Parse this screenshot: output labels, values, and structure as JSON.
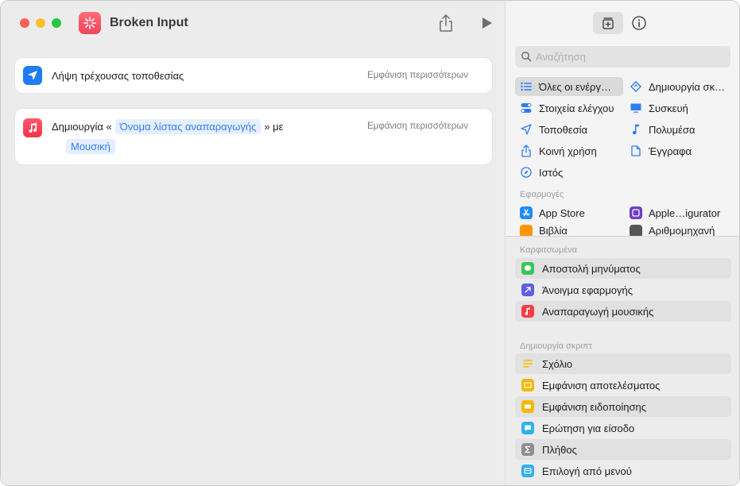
{
  "window": {
    "title": "Broken Input"
  },
  "actions": [
    {
      "text": "Λήψη τρέχουσας τοποθεσίας",
      "more": "Εμφάνιση περισσότερων"
    },
    {
      "prefix": "Δημιουργία «",
      "token1": "Όνομα λίστας αναπαραγωγής",
      "middle": "» με",
      "token2": "Μουσική",
      "more": "Εμφάνιση περισσότερων"
    }
  ],
  "sidebar": {
    "search_placeholder": "Αναζήτηση",
    "categories": [
      {
        "label": "Όλες οι ενέργ…",
        "icon": "list-icon"
      },
      {
        "label": "Δημιουργία σκ…",
        "icon": "script-icon"
      },
      {
        "label": "Στοιχεία ελέγχου",
        "icon": "toggle-icon"
      },
      {
        "label": "Συσκευή",
        "icon": "display-icon"
      },
      {
        "label": "Τοποθεσία",
        "icon": "location-icon"
      },
      {
        "label": "Πολυμέσα",
        "icon": "music-note-icon"
      },
      {
        "label": "Κοινή χρήση",
        "icon": "share-icon"
      },
      {
        "label": "Έγγραφα",
        "icon": "document-icon"
      },
      {
        "label": "Ιστός",
        "icon": "compass-icon"
      }
    ],
    "apps_label": "Εφαρμογές",
    "apps": [
      {
        "label": "App Store",
        "color": "#1d8cf8"
      },
      {
        "label": "Apple…igurator",
        "color": "#6e3fc6"
      },
      {
        "label": "Βιβλία",
        "color": "#ff9500"
      },
      {
        "label": "Αριθμομηχανή",
        "color": "#555555"
      }
    ],
    "pinned_label": "Καρφιτσωμένα",
    "pinned": [
      {
        "label": "Αποστολή μηνύματος",
        "color": "#34c759"
      },
      {
        "label": "Άνοιγμα εφαρμογής",
        "color": "#5e5ce6"
      },
      {
        "label": "Αναπαραγωγή μουσικής",
        "color": "#fc3c44"
      }
    ],
    "scripting_label": "Δημιουργία σκριπτ",
    "scripting": [
      {
        "label": "Σχόλιο",
        "color": "#f5c400"
      },
      {
        "label": "Εμφάνιση αποτελέσματος",
        "color": "#f5b800"
      },
      {
        "label": "Εμφάνιση ειδοποίησης",
        "color": "#f5b800"
      },
      {
        "label": "Ερώτηση για είσοδο",
        "color": "#30b0f0"
      },
      {
        "label": "Πλήθος",
        "color": "#8e8e93"
      },
      {
        "label": "Επιλογή από μενού",
        "color": "#30b0f0"
      }
    ]
  }
}
